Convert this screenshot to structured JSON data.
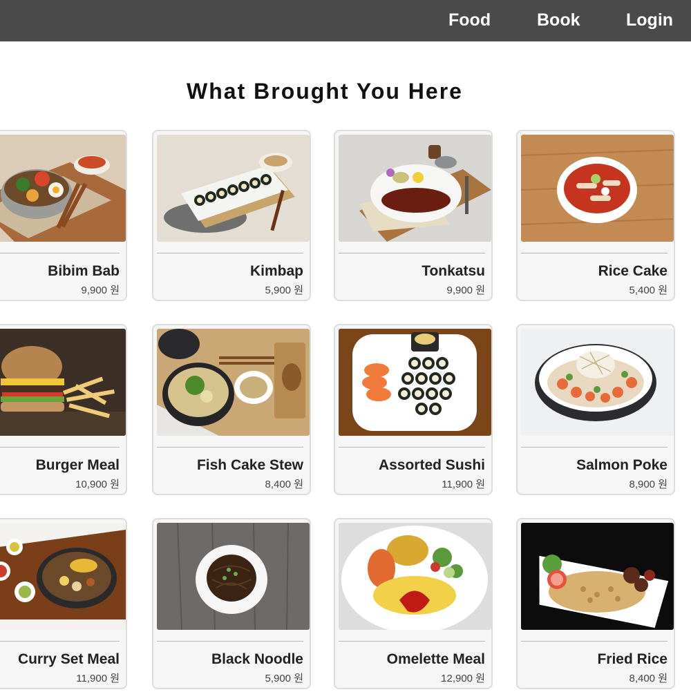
{
  "nav": {
    "food": "Food",
    "book": "Book",
    "login": "Login"
  },
  "page": {
    "title": "What Brought You Here"
  },
  "currency": "원",
  "menu": [
    {
      "name": "Bibim Bab",
      "price": "9,900 원"
    },
    {
      "name": "Kimbap",
      "price": "5,900 원"
    },
    {
      "name": "Tonkatsu",
      "price": "9,900 원"
    },
    {
      "name": "Rice Cake",
      "price": "5,400 원"
    },
    {
      "name": "Burger Meal",
      "price": "10,900 원"
    },
    {
      "name": "Fish Cake Stew",
      "price": "8,400 원"
    },
    {
      "name": "Assorted Sushi",
      "price": "11,900 원"
    },
    {
      "name": "Salmon Poke",
      "price": "8,900 원"
    },
    {
      "name": "Curry Set Meal",
      "price": "11,900 원"
    },
    {
      "name": "Black Noodle",
      "price": "5,900 원"
    },
    {
      "name": "Omelette Meal",
      "price": "12,900 원"
    },
    {
      "name": "Fried Rice",
      "price": "8,400 원"
    }
  ],
  "colors": {
    "topbar": "#4a4a4a",
    "card_background": "#f6f6f6",
    "card_border": "#dcdcdc"
  }
}
